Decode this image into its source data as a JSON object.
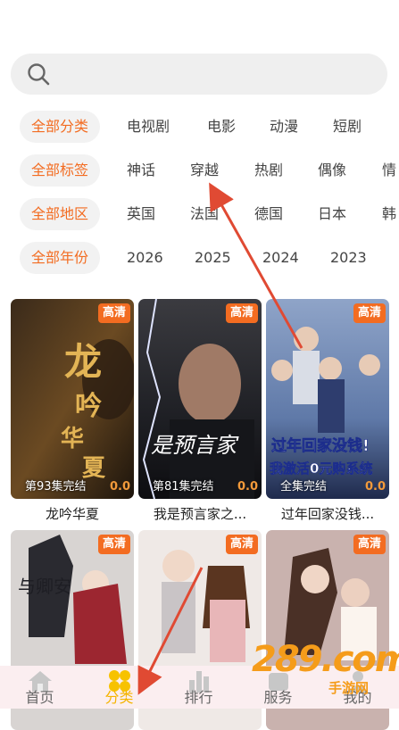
{
  "search": {
    "placeholder": ""
  },
  "filters": {
    "category": {
      "active": "全部分类",
      "options": [
        "电视剧",
        "电影",
        "动漫",
        "短剧"
      ]
    },
    "tag": {
      "active": "全部标签",
      "options": [
        "神话",
        "穿越",
        "热剧",
        "偶像",
        "情"
      ]
    },
    "region": {
      "active": "全部地区",
      "options": [
        "英国",
        "法国",
        "德国",
        "日本",
        "韩"
      ]
    },
    "year": {
      "active": "全部年份",
      "options": [
        "2026",
        "2025",
        "2024",
        "2023"
      ]
    }
  },
  "cards": [
    {
      "title": "龙吟华夏",
      "badge": "高清",
      "episode": "第93集完结",
      "score": "0.0",
      "art_text": "龙吟华夏"
    },
    {
      "title": "我是预言家之...",
      "badge": "高清",
      "episode": "第81集完结",
      "score": "0.0",
      "art_text": "是预言家之"
    },
    {
      "title": "过年回家没钱...",
      "badge": "高清",
      "episode": "全集完结",
      "score": "0.0",
      "art_text": "过年回家没钱! 我激活0元购系统"
    },
    {
      "title": "",
      "badge": "高清",
      "episode": "",
      "score": "",
      "art_text": "与卿安"
    },
    {
      "title": "",
      "badge": "高清",
      "episode": "",
      "score": "",
      "art_text": ""
    },
    {
      "title": "",
      "badge": "高清",
      "episode": "",
      "score": "",
      "art_text": ""
    }
  ],
  "tabbar": {
    "items": [
      {
        "label": "首页",
        "icon": "home-icon"
      },
      {
        "label": "分类",
        "icon": "category-icon"
      },
      {
        "label": "排行",
        "icon": "ranking-icon"
      },
      {
        "label": "服务",
        "icon": "service-icon"
      },
      {
        "label": "我的",
        "icon": "profile-icon"
      }
    ],
    "active_index": 1
  },
  "watermark": {
    "logo": "289.com",
    "sub": "手游网"
  },
  "colors": {
    "accent": "#f36c21",
    "tab_active": "#f5b400",
    "annotation_arrow": "#e04a33"
  }
}
